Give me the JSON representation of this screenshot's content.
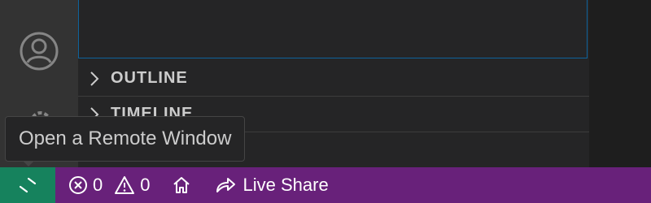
{
  "tooltip": {
    "text": "Open a Remote Window"
  },
  "sections": [
    {
      "label": "OUTLINE"
    },
    {
      "label": "TIMELINE"
    }
  ],
  "status_bar": {
    "errors": "0",
    "warnings": "0",
    "live_share_label": "Live Share"
  },
  "colors": {
    "status_bar_bg": "#68217a",
    "remote_button_bg": "#16825d",
    "focus_border": "#0e639c"
  },
  "icons": [
    "account-icon",
    "manage-gear-icon",
    "chevron-right-icon",
    "remote-icon",
    "error-icon",
    "warning-icon",
    "home-icon",
    "live-share-icon"
  ]
}
